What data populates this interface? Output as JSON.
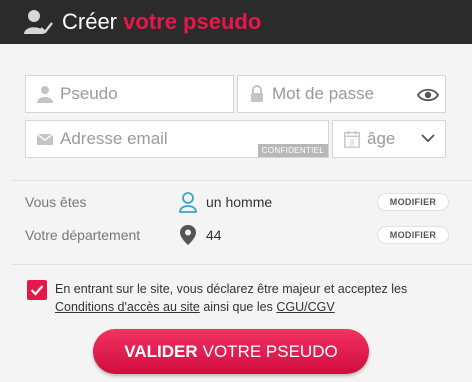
{
  "header": {
    "title_plain": "Créer",
    "title_accent": "votre pseudo"
  },
  "form": {
    "pseudo_placeholder": "Pseudo",
    "password_placeholder": "Mot de passe",
    "email_placeholder": "Adresse email",
    "email_badge": "CONFIDENTIEL",
    "age_placeholder": "âge",
    "age_icon_number": "8"
  },
  "profile": {
    "gender_label": "Vous êtes",
    "gender_value": "un homme",
    "department_label": "Votre département",
    "department_value": "44",
    "modify_label": "MODIFIER"
  },
  "consent": {
    "checked": true,
    "text_before": "En entrant sur le site, vous déclarez être majeur et acceptez les",
    "link_conditions": "Conditions d'accès au site",
    "text_middle": "ainsi que les",
    "link_cgu": "CGU/CGV"
  },
  "submit": {
    "label_bold": "VALIDER",
    "label_rest": "VOTRE PSEUDO"
  },
  "colors": {
    "accent": "#e8174a",
    "header_bg": "#2b2b2b",
    "page_bg": "#f4f4f4",
    "person_icon": "#3aa6c9"
  },
  "icons": {
    "header": "user-check-icon",
    "pseudo": "user-icon",
    "password": "lock-icon",
    "show_password": "eye-icon",
    "email": "envelope-icon",
    "age": "calendar-icon",
    "age_dropdown": "chevron-down-icon",
    "gender": "person-outline-icon",
    "department": "map-pin-icon",
    "checkbox": "checkmark-icon"
  }
}
